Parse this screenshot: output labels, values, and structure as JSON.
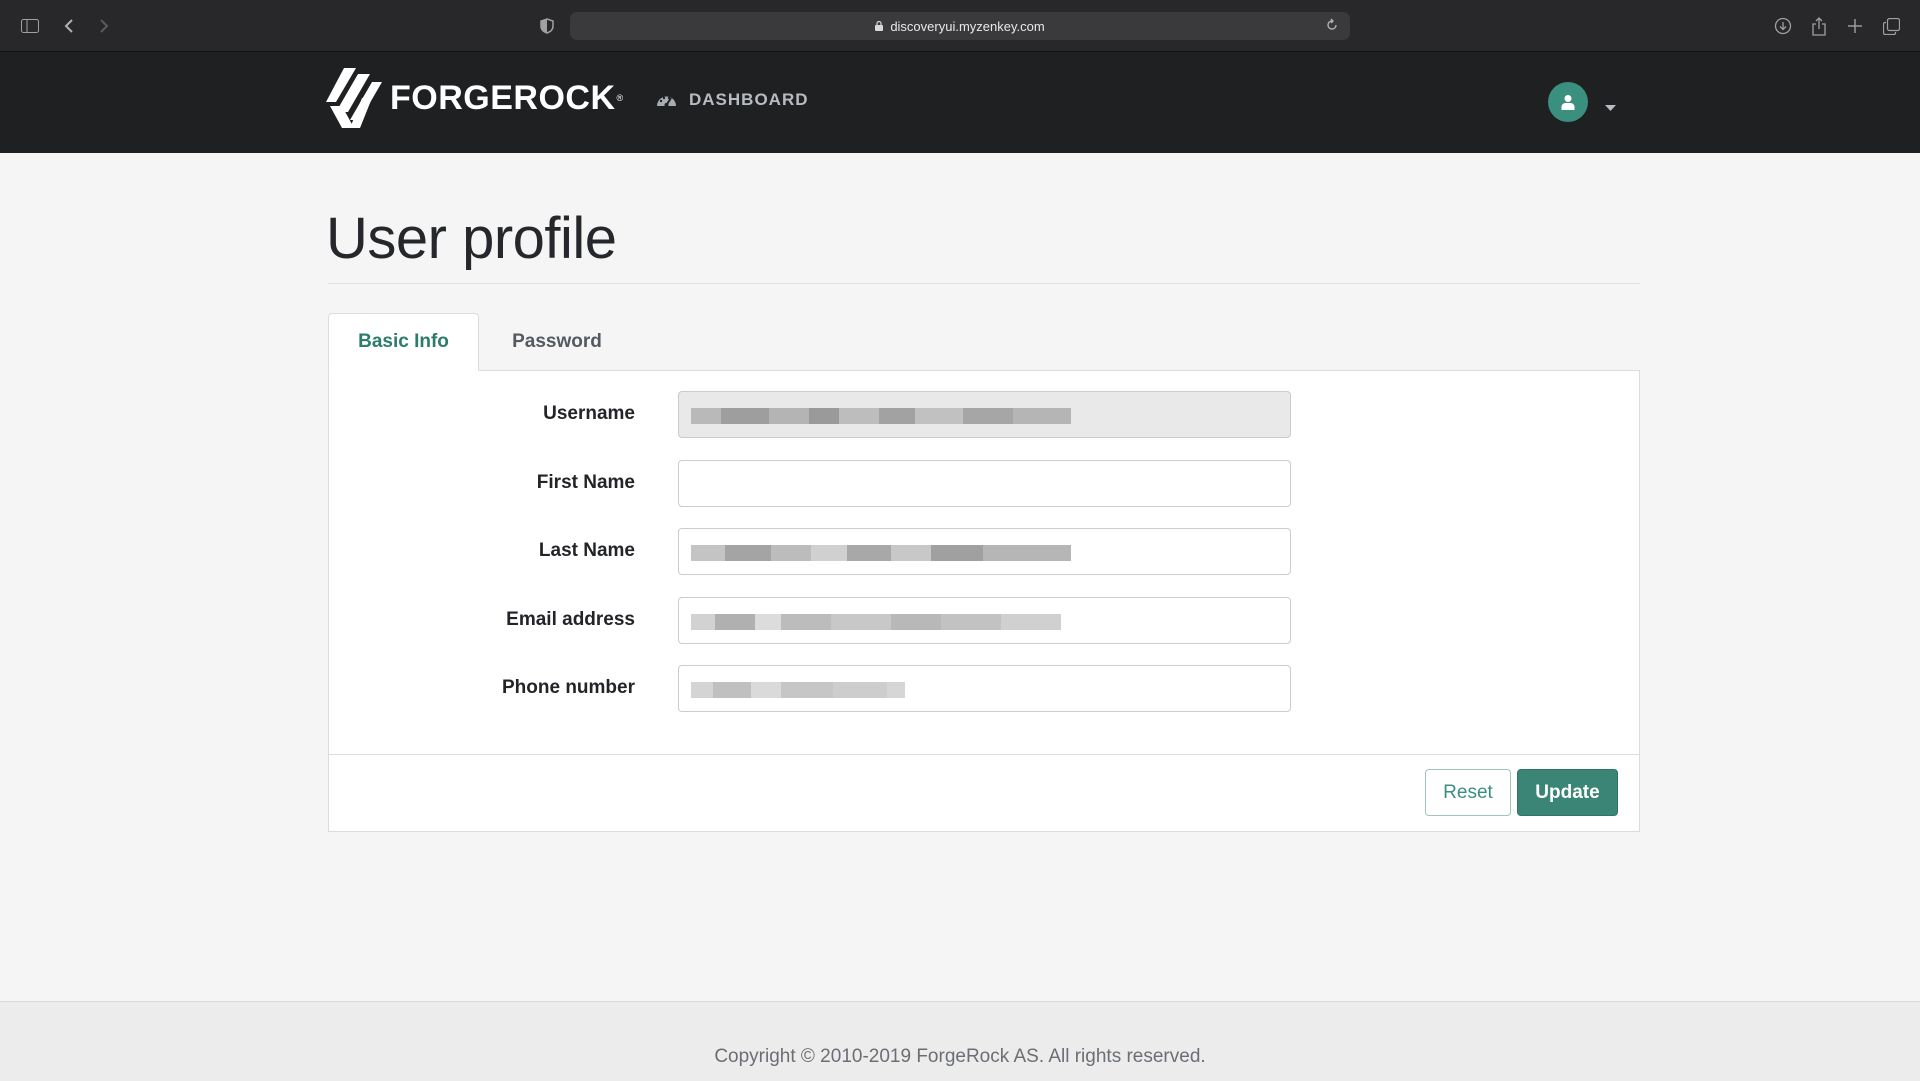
{
  "browser": {
    "url": "discoveryui.myzenkey.com",
    "icons": [
      "sidebar-icon",
      "back-icon",
      "forward-icon",
      "privacy-shield-icon",
      "lock-icon",
      "reload-icon",
      "download-icon",
      "share-icon",
      "new-tab-icon",
      "tabs-overview-icon"
    ]
  },
  "nav": {
    "brand": "FORGEROCK",
    "brand_tm": "®",
    "dashboard_label": "DASHBOARD",
    "dashboard_icon": "dashboard-gauge-icon",
    "user_icon": "user-icon"
  },
  "page": {
    "title": "User profile"
  },
  "tabs": [
    {
      "label": "Basic Info",
      "active": true
    },
    {
      "label": "Password",
      "active": false
    }
  ],
  "form": {
    "fields": [
      {
        "label": "Username",
        "value": "",
        "disabled": true,
        "redacted": true
      },
      {
        "label": "First Name",
        "value": "",
        "disabled": false,
        "redacted": false
      },
      {
        "label": "Last Name",
        "value": "",
        "disabled": false,
        "redacted": true
      },
      {
        "label": "Email address",
        "value": "",
        "disabled": false,
        "redacted": true
      },
      {
        "label": "Phone number",
        "value": "",
        "disabled": false,
        "redacted": true
      }
    ],
    "reset_label": "Reset",
    "update_label": "Update"
  },
  "footer": {
    "copyright": "Copyright © 2010-2019 ForgeRock AS. All rights reserved."
  },
  "colors": {
    "accent": "#3b8576",
    "nav_bg": "#1f2022",
    "page_bg": "#f5f5f5"
  }
}
